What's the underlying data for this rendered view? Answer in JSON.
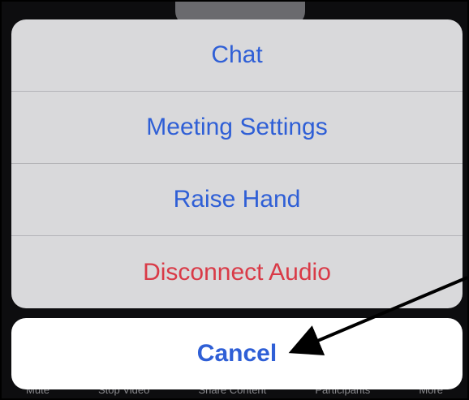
{
  "action_sheet": {
    "items": [
      {
        "label": "Chat",
        "color": "#2f5fd6"
      },
      {
        "label": "Meeting Settings",
        "color": "#2f5fd6"
      },
      {
        "label": "Raise Hand",
        "color": "#2f5fd6"
      },
      {
        "label": "Disconnect Audio",
        "color": "#d93a47"
      }
    ],
    "cancel_label": "Cancel"
  },
  "toolbar": {
    "items": [
      "Mute",
      "Stop Video",
      "Share Content",
      "Participants",
      "More"
    ]
  },
  "colors": {
    "action_text": "#2f5fd6",
    "destructive_text": "#d93a47",
    "sheet_background": "#d9d9db",
    "cancel_background": "#ffffff",
    "screen_background": "#0d0d0f"
  }
}
